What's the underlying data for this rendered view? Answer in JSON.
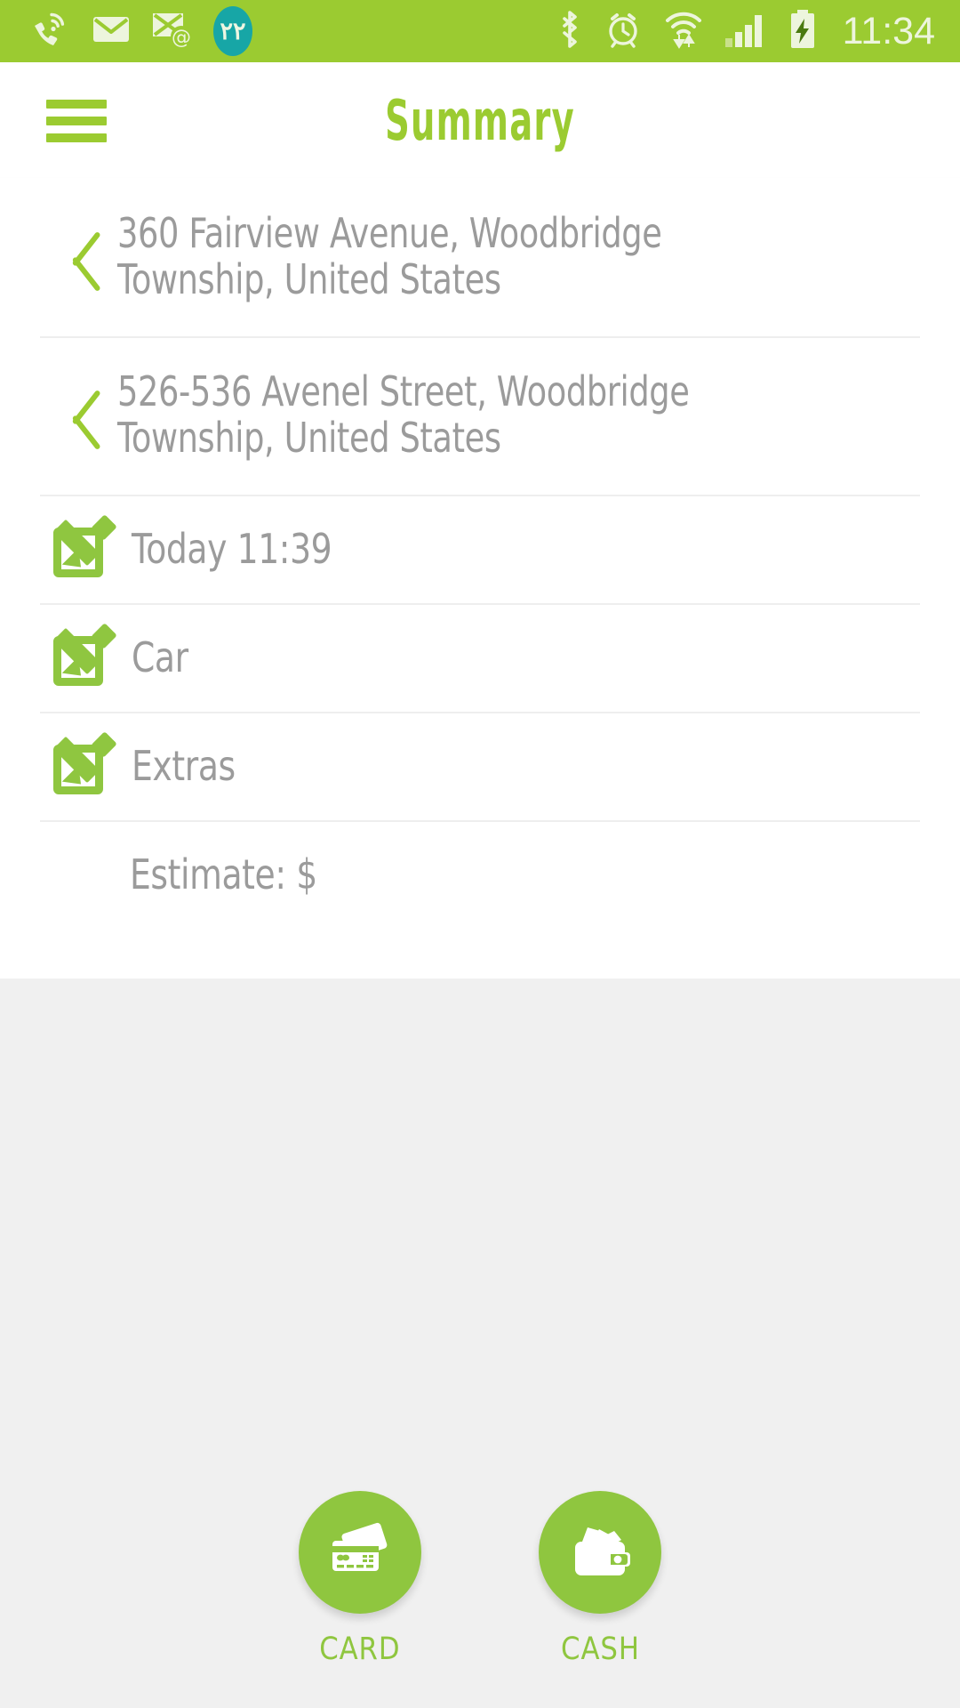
{
  "statusbar": {
    "time": "11:34",
    "badge_count": "٢٢",
    "left_icons": [
      "wifi-calling-icon",
      "sms-envelope-icon",
      "email-at-icon",
      "notification-count-badge"
    ],
    "right_icons": [
      "bluetooth-icon",
      "alarm-clock-icon",
      "wifi-data-transfer-icon",
      "cellular-signal-icon",
      "battery-charging-icon"
    ],
    "colors": {
      "background": "#9bcb31",
      "icon": "#edf5dd",
      "badge": "#17a6a6"
    }
  },
  "header": {
    "title": "Summary",
    "menu_icon": "hamburger-menu-icon",
    "title_color": "#9bcb31"
  },
  "summary": {
    "pickup": {
      "icon": "chevron-left-icon",
      "text": "360 Fairview Avenue, Woodbridge Township, United States"
    },
    "dropoff": {
      "icon": "chevron-left-icon",
      "text": "526-536 Avenel Street, Woodbridge Township, United States"
    },
    "time_row": {
      "icon": "edit-pencil-icon",
      "label": "Today 11:39"
    },
    "car_row": {
      "icon": "edit-pencil-icon",
      "label": "Car"
    },
    "extras_row": {
      "icon": "edit-pencil-icon",
      "label": "Extras"
    },
    "estimate_row": {
      "label": "Estimate: $"
    }
  },
  "payment": {
    "card": {
      "icon": "credit-cards-icon",
      "label": "CARD"
    },
    "cash": {
      "icon": "wallet-icon",
      "label": "CASH"
    },
    "accent_color": "#8fc63f"
  }
}
